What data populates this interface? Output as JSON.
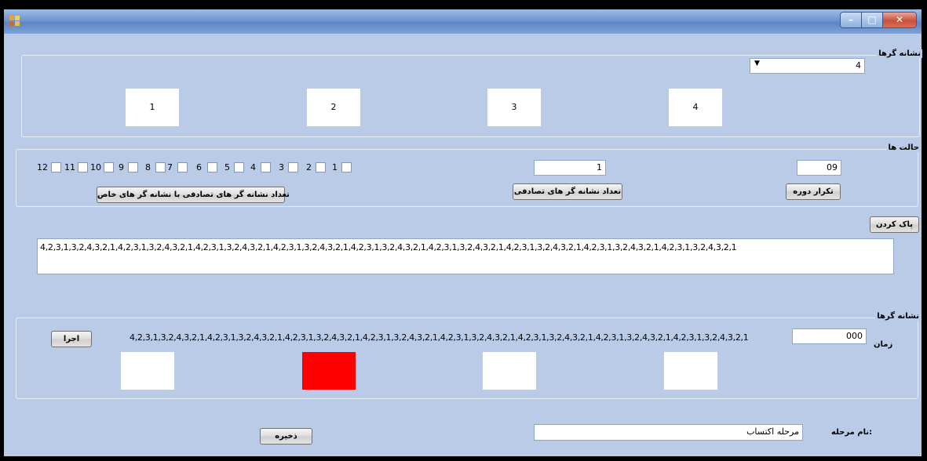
{
  "window": {
    "title": ""
  },
  "group_markers": {
    "label": "نشانه گرها",
    "select_value": "4",
    "boxes": [
      "1",
      "2",
      "3",
      "4"
    ]
  },
  "group_states": {
    "label": "حالت ها",
    "checkboxes": [
      "1",
      "2",
      "3",
      "4",
      "5",
      "6",
      "7",
      "8",
      "9",
      "10",
      "11",
      "12"
    ],
    "random_count_value": "1",
    "repeat_value": "09",
    "btn_random_special": "تعداد نشانه گر های تصادفی با نشانه گر های خاص",
    "btn_random_count": "تعداد نشانه گر های تصادفی",
    "btn_repeat": "تکرار دوره"
  },
  "clear_button": "پاک کردن",
  "sequence_text": "4,2,3,1,3,2,4,3,2,1,4,2,3,1,3,2,4,3,2,1,4,2,3,1,3,2,4,3,2,1,4,2,3,1,3,2,4,3,2,1,4,2,3,1,3,2,4,3,2,1,4,2,3,1,3,2,4,3,2,1,4,2,3,1,3,2,4,3,2,1,4,2,3,1,3,2,4,3,2,1,4,2,3,1,3,2,4,3,2,1",
  "group_run": {
    "label": "نشانه گرها",
    "run_button": "اجرا",
    "sequence_text": "4,2,3,1,3,2,4,3,2,1,4,2,3,1,3,2,4,3,2,1,4,2,3,1,3,2,4,3,2,1,4,2,3,1,3,2,4,3,2,1,4,2,3,1,3,2,4,3,2,1,4,2,3,1,3,2,4,3,2,1,4,2,3,1,3,2,4,3,2,1,4,2,3,1,3,2,4,3,2,1",
    "time_label": "زمان",
    "time_value": "000",
    "box_colors": [
      "#ffffff",
      "#ff0000",
      "#ffffff",
      "#ffffff"
    ]
  },
  "stage_name_label": "نام مرحله:",
  "stage_name_value": "مرحله اکتساب",
  "save_button": "ذخیره"
}
